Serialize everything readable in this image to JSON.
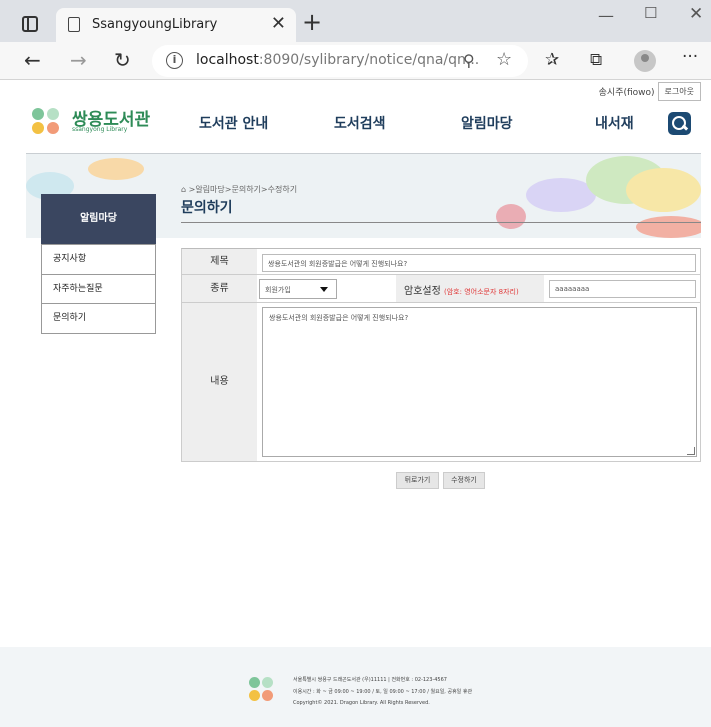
{
  "browser": {
    "tab_title": "SsangyoungLibrary",
    "url_host": "localhost",
    "url_path": ":8090/sylibrary/notice/qna/qn...",
    "window_controls": [
      "minimize-icon",
      "maximize-icon",
      "close-icon"
    ]
  },
  "header": {
    "user": "송시주(fiowo)",
    "logout_label": "로그아웃",
    "logo_title": "쌍용도서관",
    "logo_subtitle": "ssangyong Library",
    "logo_colors": [
      "#7ec59a",
      "#b6e0c5",
      "#f3c143",
      "#f29b78"
    ],
    "nav": [
      "도서관 안내",
      "도서검색",
      "알림마당",
      "내서재"
    ],
    "accent_color": "#1c4a73"
  },
  "sidebar": {
    "title": "알림마당",
    "items": [
      "공지사항",
      "자주하는질문",
      "문의하기"
    ]
  },
  "content": {
    "breadcrumb": ">알림마당>문의하기>수정하기",
    "page_title": "문의하기"
  },
  "form": {
    "title_label": "제목",
    "title_value": "쌍용도서관의 회원증발급은 어떻게 진행되나요?",
    "type_label": "종류",
    "type_value": "회원가입",
    "password_label": "암호설정",
    "password_hint": "(암호: 영어소문자 8자리)",
    "password_value": "aaaaaaaa",
    "content_label": "내용",
    "content_value": "쌍용도서관의 회원증발급은 어떻게 진행되나요?"
  },
  "buttons": {
    "back_label": "뒤로가기",
    "edit_label": "수정하기"
  },
  "footer": {
    "address": "서울특별시 쌍용구 드래곤도서관 (우)11111 | 전화번호 : 02-123-4567",
    "hours": "이용시간 : 화 ~ 금 09:00 ~ 19:00 / 토, 일 09:00 ~ 17:00 / 월요일, 공휴일 휴관",
    "copyright": "Copyright© 2021. Dragon Library. All Rights Reserved."
  }
}
